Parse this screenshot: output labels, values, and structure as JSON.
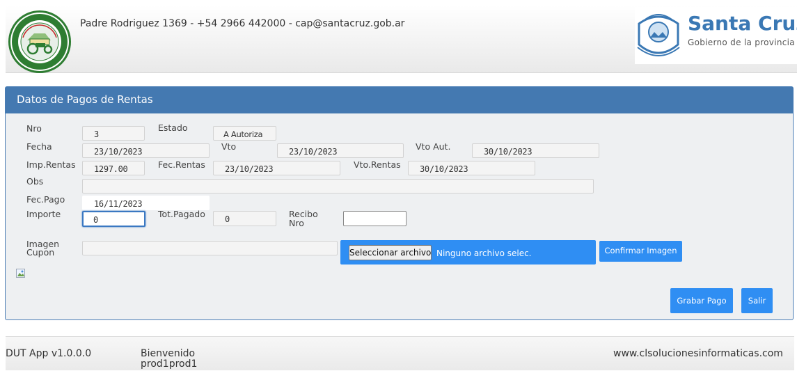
{
  "header": {
    "contact": "Padre Rodriguez 1369 - +54 2966 442000 - cap@santacruz.gob.ar",
    "brand_title": "Santa Cruz",
    "brand_subtitle": "Gobierno de la provincia"
  },
  "panel": {
    "title": "Datos de Pagos de Rentas",
    "fields": {
      "nro": {
        "label": "Nro",
        "value": "3"
      },
      "estado": {
        "label": "Estado",
        "value": "A Autoriza"
      },
      "fecha": {
        "label": "Fecha",
        "value": "23/10/2023"
      },
      "vto": {
        "label": "Vto",
        "value": "23/10/2023"
      },
      "vto_aut": {
        "label": "Vto Aut.",
        "value": "30/10/2023"
      },
      "imp_rentas": {
        "label": "Imp.Rentas",
        "value": "1297.00"
      },
      "fec_rentas": {
        "label": "Fec.Rentas",
        "value": "23/10/2023"
      },
      "vto_rentas": {
        "label": "Vto.Rentas",
        "value": "30/10/2023"
      },
      "obs": {
        "label": "Obs",
        "value": ""
      },
      "fec_pago": {
        "label": "Fec.Pago",
        "value": "16/11/2023"
      },
      "importe": {
        "label": "Importe",
        "value": "0"
      },
      "tot_pagado": {
        "label": "Tot.Pagado",
        "value": "0"
      },
      "recibo_nro": {
        "label_line1": "Recibo",
        "label_line2": "Nro",
        "value": ""
      },
      "imagen_cupon": {
        "label_line1": "Imagen",
        "label_line2": "Cupon",
        "value": ""
      }
    },
    "file": {
      "button_label": "Seleccionar archivo",
      "status": "Ninguno archivo selec."
    },
    "buttons": {
      "confirmar_imagen": "Confirmar Imagen",
      "grabar_pago": "Grabar Pago",
      "salir": "Salir"
    }
  },
  "footer": {
    "app_version": "DUT App v1.0.0.0",
    "welcome": "Bienvenido",
    "user": "prod1prod1",
    "website": "www.clsolucionesinformaticas.com"
  },
  "colors": {
    "panel_header": "#4479b1",
    "button": "#2f8ef3",
    "brand": "#3a78b4"
  }
}
